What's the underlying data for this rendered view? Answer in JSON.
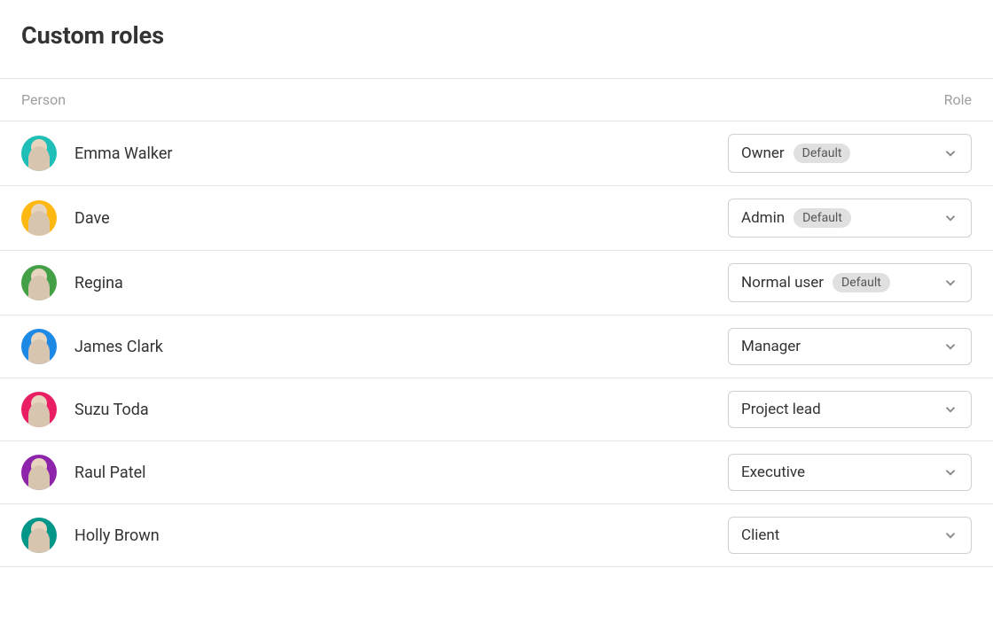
{
  "title": "Custom roles",
  "columns": {
    "person": "Person",
    "role": "Role"
  },
  "default_badge": "Default",
  "rows": [
    {
      "name": "Emma Walker",
      "role": "Owner",
      "is_default": true,
      "avatar_color": "#1fbfb8"
    },
    {
      "name": "Dave",
      "role": "Admin",
      "is_default": true,
      "avatar_color": "#fdb813"
    },
    {
      "name": "Regina",
      "role": "Normal user",
      "is_default": true,
      "avatar_color": "#43a047"
    },
    {
      "name": "James Clark",
      "role": "Manager",
      "is_default": false,
      "avatar_color": "#1e88e5"
    },
    {
      "name": "Suzu Toda",
      "role": "Project lead",
      "is_default": false,
      "avatar_color": "#e91e63"
    },
    {
      "name": "Raul Patel",
      "role": "Executive",
      "is_default": false,
      "avatar_color": "#8e24aa"
    },
    {
      "name": "Holly Brown",
      "role": "Client",
      "is_default": false,
      "avatar_color": "#009688"
    }
  ]
}
